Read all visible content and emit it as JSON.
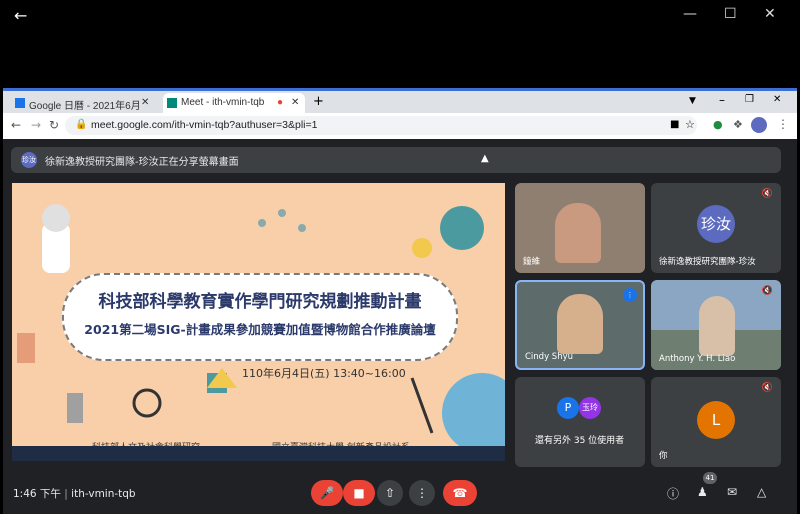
{
  "browser": {
    "tabs": [
      {
        "label": "Google 日曆 - 2021年6月"
      },
      {
        "label": "Meet - ith-vmin-tqb"
      }
    ],
    "url": "meet.google.com/ith-vmin-tqb?authuser=3&pli=1"
  },
  "notice": {
    "avatar": "珍汝",
    "text": "徐新逸教授研究團隊-珍汝正在分享螢幕畫面"
  },
  "slide": {
    "title": "科技部科學教育實作學門研究規劃推動計畫",
    "subtitle": "2021第二場SIG-計畫成果參加競賽加值暨博物館合作推廣論壇",
    "date": "110年6月4日(五) 13:40~16:00",
    "footer": "科技部人文及社會科學研究…　　　　　　　國立臺灣科技大學 創新產品設計系"
  },
  "tiles": [
    {
      "name": "鐘維",
      "video": true
    },
    {
      "name": "徐新逸教授研究團隊-珍汝",
      "avatar": "珍汝",
      "avatar_color": "#5c6bc0",
      "muted": true
    },
    {
      "name": "Cindy Shyu",
      "video": true,
      "speaking": true
    },
    {
      "name": "Anthony Y. H. Liao",
      "video": true,
      "muted": true
    },
    {
      "name": "還有另外 35 位使用者",
      "avatars": [
        "P",
        "玉玲"
      ]
    },
    {
      "name": "你",
      "avatar": "L",
      "avatar_color": "#e37400",
      "muted": true
    }
  ],
  "bottom": {
    "time_label": "1:46 下午",
    "meeting_code": "ith-vmin-tqb",
    "participant_count": "41"
  },
  "colors": {
    "accent": "#8ab4f8",
    "end_call": "#ea4335",
    "muted_red": "#ea4335"
  }
}
